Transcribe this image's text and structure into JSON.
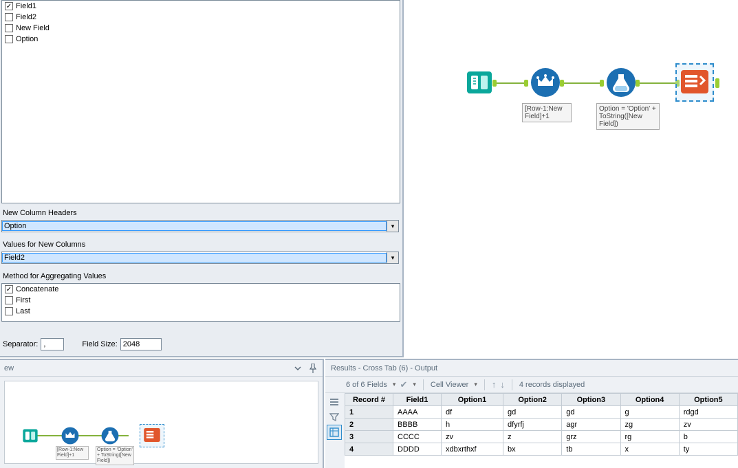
{
  "config": {
    "fieldList": [
      {
        "name": "Field1",
        "checked": true
      },
      {
        "name": "Field2",
        "checked": false
      },
      {
        "name": "New Field",
        "checked": false
      },
      {
        "name": "Option",
        "checked": false
      }
    ],
    "newColHeadersLabel": "New Column Headers",
    "newColHeadersValue": "Option",
    "valuesLabel": "Values for New Columns",
    "valuesValue": "Field2",
    "methodLabel": "Method for Aggregating Values",
    "aggOptions": [
      {
        "name": "Concatenate",
        "checked": true
      },
      {
        "name": "First",
        "checked": false
      },
      {
        "name": "Last",
        "checked": false
      }
    ],
    "separatorLabel": "Separator:",
    "separatorValue": ",",
    "fieldSizeLabel": "Field Size:",
    "fieldSizeValue": "2048"
  },
  "canvasBig": {
    "tool2Label": "[Row-1:New Field]+1",
    "tool3Label": "Option = 'Option' + ToString([New Field])"
  },
  "overview": {
    "title": "ew",
    "tool2Label": "[Row-1:New Field]+1",
    "tool3Label": "Option = 'Option' + ToString([New Field])"
  },
  "results": {
    "title": "Results - Cross Tab (6) - Output",
    "fieldsSummary": "6 of 6 Fields",
    "cellViewer": "Cell Viewer",
    "recordsText": "4 records displayed",
    "columns": [
      "Record #",
      "Field1",
      "Option1",
      "Option2",
      "Option3",
      "Option4",
      "Option5"
    ],
    "rows": [
      [
        "1",
        "AAAA",
        "df",
        "gd",
        "gd",
        "g",
        "rdgd"
      ],
      [
        "2",
        "BBBB",
        "h",
        "dfyrfj",
        "agr",
        "zg",
        "zv"
      ],
      [
        "3",
        "CCCC",
        "zv",
        "z",
        "grz",
        "rg",
        "b"
      ],
      [
        "4",
        "DDDD",
        "xdbxrthxf",
        "bx",
        "tb",
        "x",
        "ty"
      ]
    ]
  }
}
